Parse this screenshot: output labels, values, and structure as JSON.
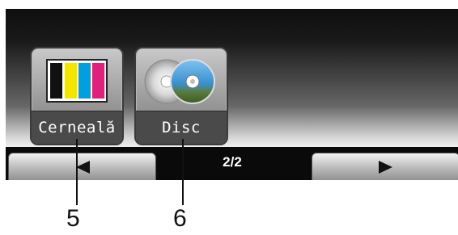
{
  "tiles": [
    {
      "label": "Cerneală",
      "icon": "ink-cartridges-icon",
      "colors": [
        "#111111",
        "#f5e600",
        "#00a0e0",
        "#e0207a"
      ]
    },
    {
      "label": "Disc",
      "icon": "disc-icon"
    }
  ],
  "nav": {
    "page_indicator": "2/2",
    "prev_icon": "left-arrow-icon",
    "next_icon": "right-arrow-icon"
  },
  "callouts": [
    "5",
    "6"
  ]
}
